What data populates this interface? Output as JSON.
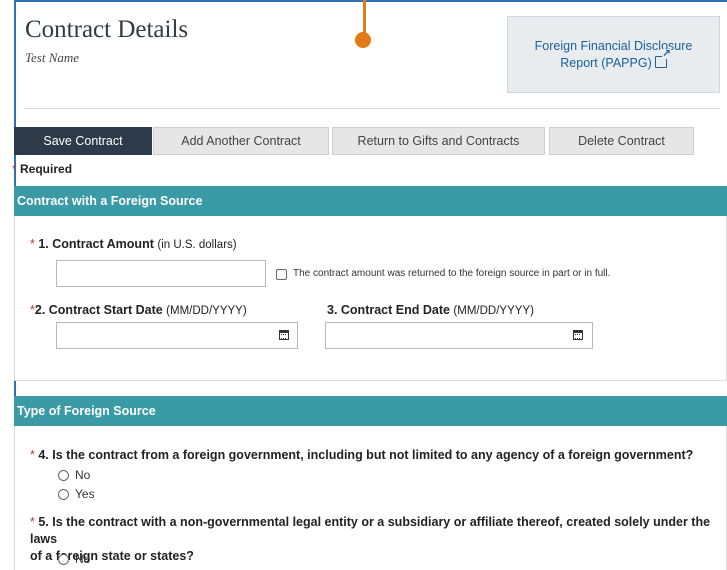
{
  "header": {
    "title": "Contract Details",
    "subtitle": "Test Name",
    "report_link": "Foreign Financial Disclosure Report (PAPPG)"
  },
  "toolbar": {
    "save": "Save Contract",
    "add": "Add Another Contract",
    "return": "Return to Gifts and Contracts",
    "delete": "Delete Contract"
  },
  "required_mark": "*",
  "required_label": "Required",
  "section1": {
    "title": "Contract with a Foreign Source",
    "q1_label": "1. Contract Amount",
    "q1_hint": "(in U.S. dollars)",
    "q1_value": "",
    "returned_checkbox_label": "The contract amount was returned to the foreign source in part or in full.",
    "returned_checked": false,
    "q2_label": "2. Contract Start Date",
    "q2_hint": "(MM/DD/YYYY)",
    "q2_value": "",
    "q3_label": "3. Contract End Date",
    "q3_hint": "(MM/DD/YYYY)",
    "q3_value": ""
  },
  "section2": {
    "title": "Type of Foreign Source",
    "q4": "4. Is the contract from a foreign government, including but not limited to any agency of a foreign government?",
    "q4_options": [
      "No",
      "Yes"
    ],
    "q5_line1": "5. Is the contract with a non-governmental legal entity or a subsidiary or affiliate thereof, created solely under the laws",
    "q5_line2": "of a foreign state or states?",
    "q5_options": [
      "No"
    ]
  },
  "icons": {
    "external_link": "external-link-icon",
    "calendar": "calendar-icon"
  },
  "colors": {
    "section_header": "#3a9aa5",
    "primary_button": "#2c3a4a",
    "link": "#1b5f9e",
    "required_star": "#c0392b",
    "annotation_pointer": "#e07b16",
    "frame_line": "#2e6fb5"
  }
}
